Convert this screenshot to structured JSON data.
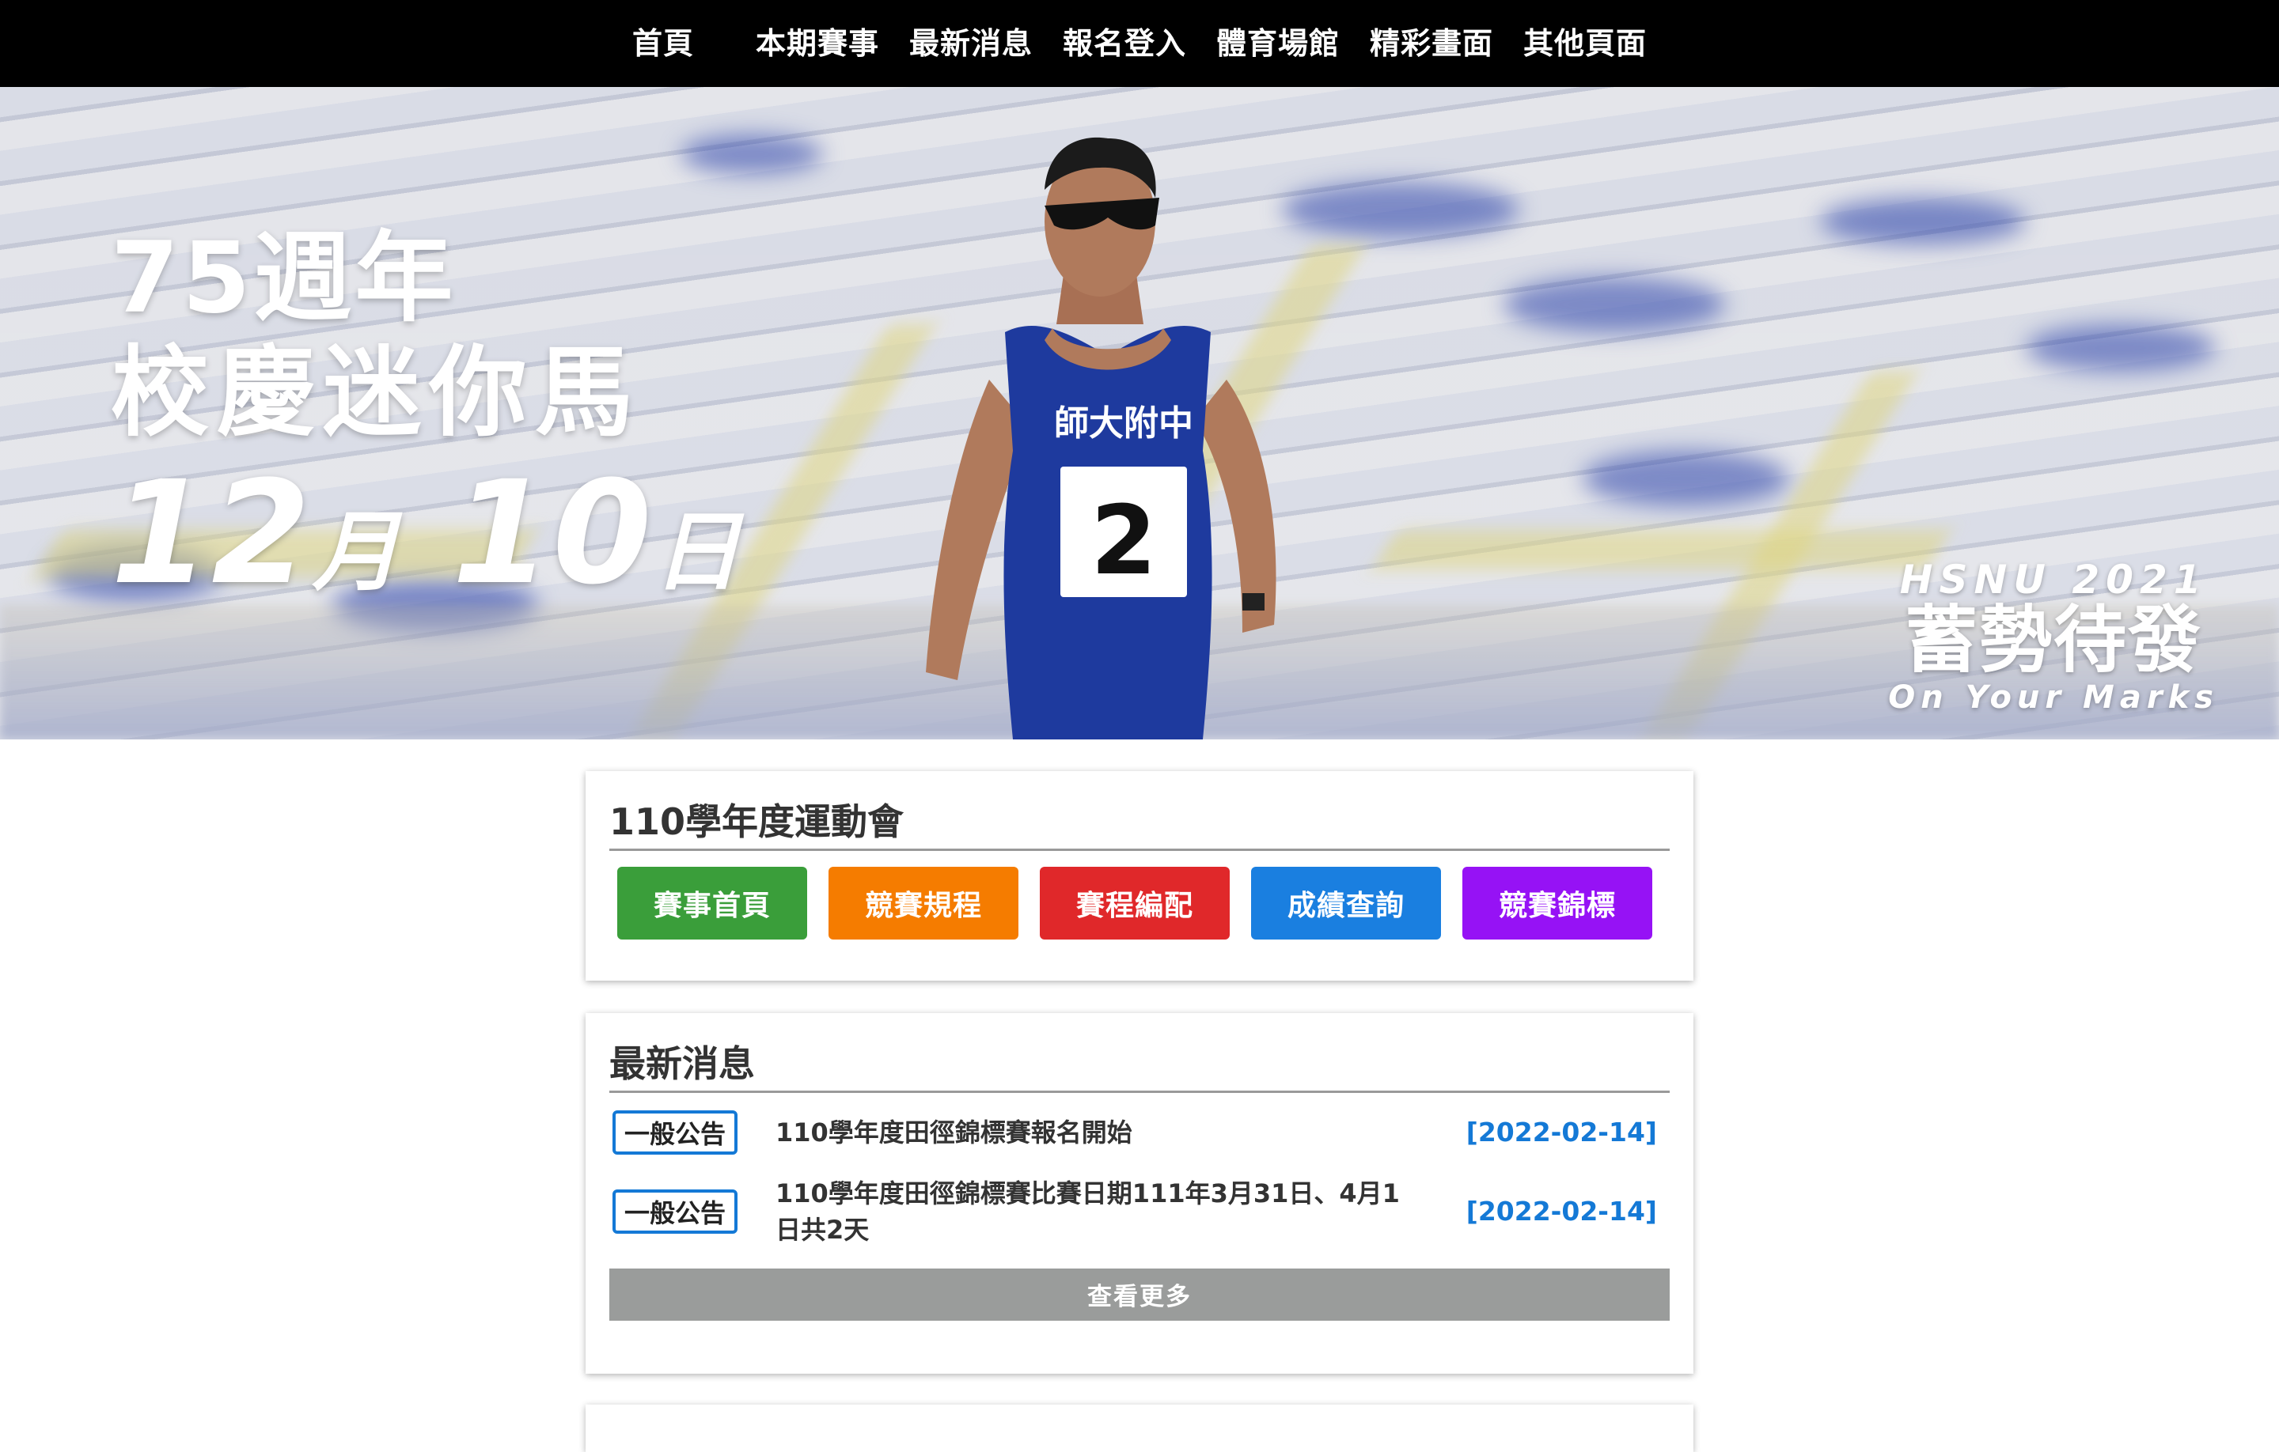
{
  "nav": {
    "items": [
      {
        "label": "首頁"
      },
      {
        "label": "本期賽事"
      },
      {
        "label": "最新消息"
      },
      {
        "label": "報名登入"
      },
      {
        "label": "體育場館"
      },
      {
        "label": "精彩畫面"
      },
      {
        "label": "其他頁面"
      }
    ]
  },
  "hero": {
    "line1": "75週年",
    "line2": "校慶迷你馬",
    "date_month_num": "12",
    "date_month_unit": "月",
    "date_day_num": "10",
    "date_day_unit": "日",
    "jersey_text": "師大附中",
    "bib_number": "2",
    "tagline1": "HSNU 2021",
    "tagline2": "蓄勢待發",
    "tagline3": "On Your Marks"
  },
  "event_card": {
    "title": "110學年度運動會",
    "buttons": [
      {
        "label": "賽事首頁",
        "color": "#3a9e3a"
      },
      {
        "label": "競賽規程",
        "color": "#f57c00"
      },
      {
        "label": "賽程編配",
        "color": "#e0282a"
      },
      {
        "label": "成績查詢",
        "color": "#1a7fe0"
      },
      {
        "label": "競賽錦標",
        "color": "#9612f5"
      }
    ]
  },
  "news_card": {
    "title": "最新消息",
    "items": [
      {
        "badge": "一般公告",
        "title": "110學年度田徑錦標賽報名開始",
        "date": "[2022-02-14]"
      },
      {
        "badge": "一般公告",
        "title": "110學年度田徑錦標賽比賽日期111年3月31日、4月1 日共2天",
        "date": "[2022-02-14]"
      }
    ],
    "more_label": "查看更多"
  }
}
